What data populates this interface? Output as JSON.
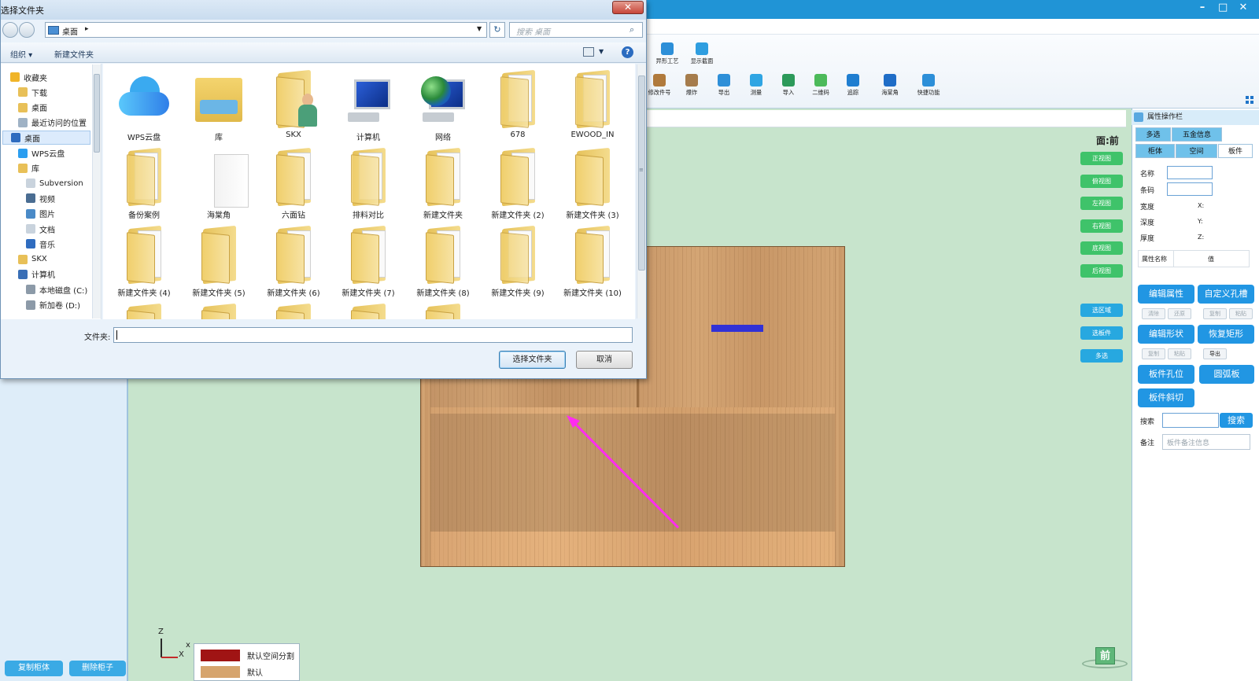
{
  "app": {
    "window_controls": [
      "–",
      "□",
      "✕"
    ],
    "ribbon_top": [
      {
        "label": "异形工艺",
        "icon": "special-shape-process-icon",
        "color": "#2d8fd8"
      },
      {
        "label": "显示截面",
        "icon": "show-section-icon",
        "color": "#2f9ee0"
      }
    ],
    "ribbon_bottom": [
      {
        "label": "修改件号",
        "icon": "edit-part-number-icon",
        "color": "#b07a3c"
      },
      {
        "label": "爆炸",
        "icon": "explode-icon",
        "color": "#a57c4c"
      },
      {
        "label": "导出",
        "icon": "export-icon",
        "color": "#2d8fd8"
      },
      {
        "label": "测量",
        "icon": "measure-icon",
        "color": "#2fa5e3"
      },
      {
        "label": "导入",
        "icon": "import-icon",
        "color": "#2c9a5a"
      },
      {
        "label": "二维码",
        "icon": "cloud-qrcode-icon",
        "color": "#4cba5a"
      },
      {
        "label": "追踪",
        "icon": "track-icon",
        "color": "#1f7ed0"
      },
      {
        "label": "海棠角",
        "icon": "crabapple-corner-icon",
        "color": "#1f6dc7"
      },
      {
        "label": "快捷功能",
        "icon": "quick-function-icon",
        "color": "#2d8fd8"
      }
    ]
  },
  "canvas": {
    "face_label": "面:前",
    "view_buttons": [
      "正视图",
      "俯视图",
      "左视图",
      "右视图",
      "底视图",
      "后视图"
    ],
    "select_buttons": [
      "选区域",
      "选板件",
      "多选"
    ],
    "axis": {
      "z": "Z",
      "x": "X",
      "y": "x"
    },
    "legend": [
      {
        "label": "默认空间分割",
        "color": "#a01414"
      },
      {
        "label": "默认",
        "color": "#d6a46d"
      }
    ],
    "front_badge": "前"
  },
  "left_panel": {
    "copy_button": "复制柜体",
    "delete_button": "删除柜子"
  },
  "right_panel": {
    "title": "属性操作栏",
    "tabs_row1": [
      "多选",
      "五金信息"
    ],
    "tabs_row2": [
      "柜体",
      "空间",
      "板件"
    ],
    "fields": {
      "name": "名称",
      "code": "条码",
      "width": "宽度",
      "depth": "深度",
      "thickness": "厚度",
      "x": "X:",
      "y": "Y:",
      "z": "Z:"
    },
    "prop_table": {
      "col1": "属性名称",
      "col2": "值"
    },
    "buttons": {
      "edit_props": "编辑属性",
      "custom_hole": "自定义孔槽",
      "clear": "清除",
      "restore": "还原",
      "copy1": "复制",
      "paste1": "粘贴",
      "edit_shape": "编辑形状",
      "restore_rect": "恢复矩形",
      "copy2": "复制",
      "paste2": "粘贴",
      "export": "导出",
      "panel_holes": "板件孔位",
      "arc_panel": "圆弧板",
      "panel_bevel": "板件斜切"
    },
    "search_label": "搜索",
    "search_button": "搜索",
    "note_label": "备注",
    "note_placeholder": "板件备注信息"
  },
  "dialog": {
    "title": "选择文件夹",
    "address": {
      "location": "桌面",
      "separator": "▸"
    },
    "search_placeholder": "搜索 桌面",
    "toolbar": {
      "organize": "组织 ▾",
      "new_folder": "新建文件夹"
    },
    "nav_items": [
      {
        "label": "收藏夹",
        "icon": "favorites-star-icon",
        "color": "#f0b428",
        "indent": 0
      },
      {
        "label": "下载",
        "icon": "download-folder-icon",
        "color": "#e8c058",
        "indent": 1
      },
      {
        "label": "桌面",
        "icon": "desktop-folder-icon",
        "color": "#e8c058",
        "indent": 1
      },
      {
        "label": "最近访问的位置",
        "icon": "recent-places-icon",
        "color": "#9fb2c5",
        "indent": 1
      },
      {
        "label": "桌面",
        "icon": "desktop-icon",
        "color": "#2f6cbf",
        "indent": 0,
        "selected": true
      },
      {
        "label": "WPS云盘",
        "icon": "wps-cloud-icon",
        "color": "#2b9ef0",
        "indent": 1
      },
      {
        "label": "库",
        "icon": "library-icon",
        "color": "#e8c058",
        "indent": 1
      },
      {
        "label": "Subversion",
        "icon": "subversion-icon",
        "color": "#c9d3dd",
        "indent": 2
      },
      {
        "label": "视频",
        "icon": "video-library-icon",
        "color": "#4a6d92",
        "indent": 2
      },
      {
        "label": "图片",
        "icon": "picture-library-icon",
        "color": "#4a8ac7",
        "indent": 2
      },
      {
        "label": "文档",
        "icon": "document-library-icon",
        "color": "#c9d3dd",
        "indent": 2
      },
      {
        "label": "音乐",
        "icon": "music-library-icon",
        "color": "#2f6cbf",
        "indent": 2
      },
      {
        "label": "SKX",
        "icon": "user-folder-icon",
        "color": "#e8c058",
        "indent": 1
      },
      {
        "label": "计算机",
        "icon": "computer-icon",
        "color": "#3a6fb6",
        "indent": 1
      },
      {
        "label": "本地磁盘 (C:)",
        "icon": "local-disk-icon",
        "color": "#8c9aa8",
        "indent": 2
      },
      {
        "label": "新加卷 (D:)",
        "icon": "volume-disk-icon",
        "color": "#8c9aa8",
        "indent": 2
      }
    ],
    "files": [
      {
        "label": "WPS云盘",
        "kind": "cloud"
      },
      {
        "label": "库",
        "kind": "library"
      },
      {
        "label": "SKX",
        "kind": "user"
      },
      {
        "label": "计算机",
        "kind": "computer"
      },
      {
        "label": "网络",
        "kind": "network"
      },
      {
        "label": "678",
        "kind": "folder-docs"
      },
      {
        "label": "EWOOD_IN",
        "kind": "folder-docs"
      },
      {
        "label": "备份案例",
        "kind": "folder-docs"
      },
      {
        "label": "海棠角",
        "kind": "white-doc"
      },
      {
        "label": "六面钻",
        "kind": "folder"
      },
      {
        "label": "排料对比",
        "kind": "folder-docs"
      },
      {
        "label": "新建文件夹",
        "kind": "folder"
      },
      {
        "label": "新建文件夹 (2)",
        "kind": "folder"
      },
      {
        "label": "新建文件夹 (3)",
        "kind": "folder-empty"
      },
      {
        "label": "新建文件夹 (4)",
        "kind": "folder"
      },
      {
        "label": "新建文件夹 (5)",
        "kind": "folder-empty"
      },
      {
        "label": "新建文件夹 (6)",
        "kind": "folder"
      },
      {
        "label": "新建文件夹 (7)",
        "kind": "folder"
      },
      {
        "label": "新建文件夹 (8)",
        "kind": "folder"
      },
      {
        "label": "新建文件夹 (9)",
        "kind": "folder-docs"
      },
      {
        "label": "新建文件夹 (10)",
        "kind": "folder"
      }
    ],
    "folder_label": "文件夹:",
    "folder_value": "",
    "select_button": "选择文件夹",
    "cancel_button": "取消",
    "close_symbol": "✕",
    "help_symbol": "?",
    "refresh_symbol": "↻",
    "search_symbol": "⌕",
    "scroll_grip": "≡"
  }
}
